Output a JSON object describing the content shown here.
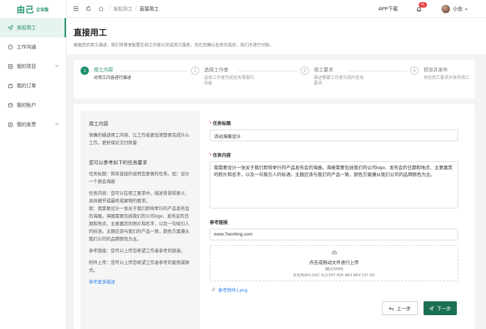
{
  "brand": {
    "logo": "由己",
    "edition": "企业版"
  },
  "sidebar": {
    "items": [
      {
        "label": "发起用工",
        "icon": "send-icon",
        "active": true
      },
      {
        "label": "工作沟通",
        "icon": "chat-icon"
      },
      {
        "label": "我的项目",
        "icon": "project-icon",
        "expandable": true
      },
      {
        "label": "我的订单",
        "icon": "order-icon"
      },
      {
        "label": "我的账户",
        "icon": "account-icon"
      },
      {
        "label": "我的发票",
        "icon": "invoice-icon",
        "expandable": true
      }
    ]
  },
  "topbar": {
    "breadcrumb": [
      "发起用工",
      "直接用工"
    ],
    "app_download": "APP下载",
    "notification_count": "41",
    "username": "小由"
  },
  "header": {
    "title": "直接用工",
    "desc": "根据您的用工描述，我们将尊享配置在线工作者以完成用工服务，仅在您确认任务完成后，我们才进行付款。"
  },
  "steps": [
    {
      "num": "1",
      "title": "用工内容",
      "desc": "对用工内容进行描述",
      "active": true
    },
    {
      "num": "2",
      "title": "选择工作者",
      "desc": "选择工作者完成任务需要的技能"
    },
    {
      "num": "3",
      "title": "用工要求",
      "desc": "描述需要工作者完成的任务要求"
    },
    {
      "num": "4",
      "title": "预览并发布",
      "desc": "预览用工要求并发布用工"
    }
  ],
  "guide": {
    "title": "用工内容",
    "intro": "准确的描述用工内容，让工作者更加清楚要完成什么工作，更好保证交付质量",
    "sub_title": "您可以参考如下的任务要求",
    "p1": "任务标题：简单直接的说明您要做的任务。如：设计一个展会海报",
    "p2": "任务内容：您可以在用工要求中，描述背景和意义、具体细节或最终成果物的要求。\n如：我需要设计一张关于我们即将举行的产品发布会的海报。海报需要包括我们的公司logo、发布会的日期和地点、主要嘉宾的照片和名字，以及一句吸引人的标语。主题应该与我们的产品一致，颜色方案遵从我们公司的品牌颜色为主。",
    "p3": "参考链接：您可以上传您希望工作者参考的链接。",
    "p4": "附件上传：您可以上传您希望工作者参考的案例或样式。",
    "link": "参考更多描述"
  },
  "form": {
    "title_label": "任务标题",
    "title_value": "活动海报设计",
    "content_label": "任务内容",
    "content_value": "我需要设计一张关于我们即将举行的产品发布会的海报。海报需要包括我们的公司logo、发布会的日期和地点、主要嘉宾的照片和名字，以及一句吸引人的标语。主题应该与我们的产品一致，颜色方案遵从我们公司的品牌颜色为主。",
    "link_label": "参考链接",
    "link_value": "www.7working.com",
    "upload_text": "点击或拖动文件进行上传",
    "upload_limit": "(最大200M)",
    "upload_types": "仅支持JPG DOC XLS PPT PDF MP3 MP4 TXT ZIP",
    "file_name": "参考附件1.png"
  },
  "buttons": {
    "prev": "上一步",
    "next": "下一步"
  },
  "colors": {
    "accent": "#1b8f6e",
    "button_primary": "#1b6f55",
    "link": "#2a7ff0",
    "badge": "#e64242"
  }
}
